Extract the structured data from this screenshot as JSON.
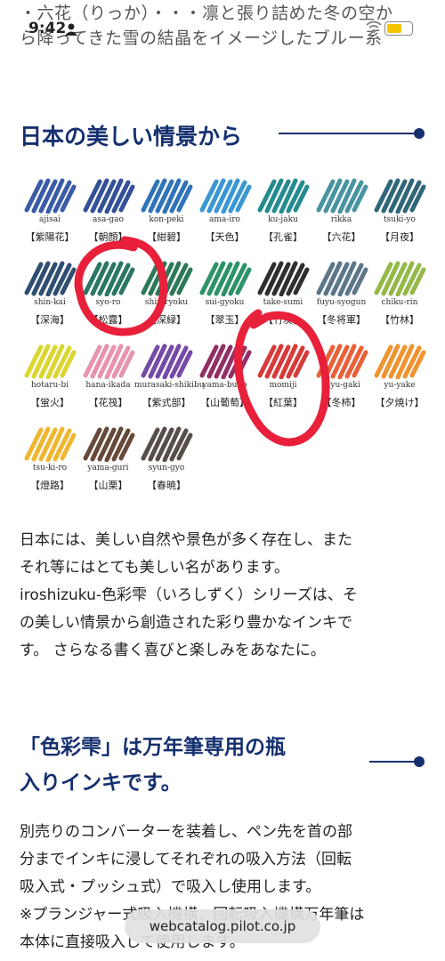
{
  "status_bar": {
    "time": "9:42",
    "overlay_text_line1": "・六花（りっか）・・・凛と張り詰めた冬の空か",
    "overlay_text_line2": "ら降ってきた雪の結晶をイメージしたブルー系"
  },
  "section1": {
    "heading": "日本の美しい情景から"
  },
  "swatches": [
    {
      "romaji": "ajisai",
      "kanji": "【紫陽花】",
      "color": "#2a4fa0"
    },
    {
      "romaji": "asa-gao",
      "kanji": "【朝顔】",
      "color": "#23428f"
    },
    {
      "romaji": "kon-peki",
      "kanji": "【紺碧】",
      "color": "#1f68b3"
    },
    {
      "romaji": "ama-iro",
      "kanji": "【天色】",
      "color": "#2a8fd0"
    },
    {
      "romaji": "ku-jaku",
      "kanji": "【孔雀】",
      "color": "#138285"
    },
    {
      "romaji": "rikka",
      "kanji": "【六花】",
      "color": "#3a8c9a"
    },
    {
      "romaji": "tsuki-yo",
      "kanji": "【月夜】",
      "color": "#1f5a6e"
    },
    {
      "romaji": "shin-kai",
      "kanji": "【深海】",
      "color": "#1f3f66"
    },
    {
      "romaji": "syo-ro",
      "kanji": "【松露】",
      "color": "#1a6b5b"
    },
    {
      "romaji": "shin-ryoku",
      "kanji": "【深緑】",
      "color": "#1b6d4a"
    },
    {
      "romaji": "sui-gyoku",
      "kanji": "【翠玉】",
      "color": "#1c8a5a"
    },
    {
      "romaji": "take-sumi",
      "kanji": "【竹炭】",
      "color": "#1e1e1e"
    },
    {
      "romaji": "fuyu-syogun",
      "kanji": "【冬将軍】",
      "color": "#4f6b80"
    },
    {
      "romaji": "chiku-rin",
      "kanji": "【竹林】",
      "color": "#8cb43a"
    },
    {
      "romaji": "hotaru-bi",
      "kanji": "【蛍火】",
      "color": "#d9d320"
    },
    {
      "romaji": "hana-ikada",
      "kanji": "【花筏】",
      "color": "#e58aa8"
    },
    {
      "romaji": "murasaki-shikibu",
      "kanji": "【紫式部】",
      "color": "#6a3aa0"
    },
    {
      "romaji": "yama-budo",
      "kanji": "【山葡萄】",
      "color": "#8a1e5a"
    },
    {
      "romaji": "momiji",
      "kanji": "【紅葉】",
      "color": "#d42a2a"
    },
    {
      "romaji": "fuyu-gaki",
      "kanji": "【冬柿】",
      "color": "#e8542a"
    },
    {
      "romaji": "yu-yake",
      "kanji": "【夕焼け】",
      "color": "#ef8a20"
    },
    {
      "romaji": "tsu-ki-ro",
      "kanji": "【燈路】",
      "color": "#eeb020"
    },
    {
      "romaji": "yama-guri",
      "kanji": "【山栗】",
      "color": "#5a3a28"
    },
    {
      "romaji": "syun-gyo",
      "kanji": "【春暁】",
      "color": "#4a3f3a"
    }
  ],
  "paragraph1": [
    "日本には、美しい自然や景色が多く存在し、また",
    "それ等にはとても美しい名があります。",
    "iroshizuku-色彩雫（いろしずく）シリーズは、そ",
    "の美しい情景から創造された彩り豊かなインキで",
    "す。 さらなる書く喜びと楽しみをあなたに。"
  ],
  "section2": {
    "heading_line1": "「色彩雫」は万年筆専用の瓶",
    "heading_line2": "入りインキです。"
  },
  "paragraph2": [
    "別売りのコンバーターを装着し、ペン先を首の部",
    "分までインキに浸してそれぞれの吸入方法（回転",
    "吸入式・プッシュ式）で吸入し使用します。",
    "※プランジャー式吸入機構、回転吸入機構万年筆は",
    "本体に直接吸入して使用します。"
  ],
  "browser": {
    "url": "webcatalog.pilot.co.jp"
  },
  "annotation_color": "#e8203a"
}
